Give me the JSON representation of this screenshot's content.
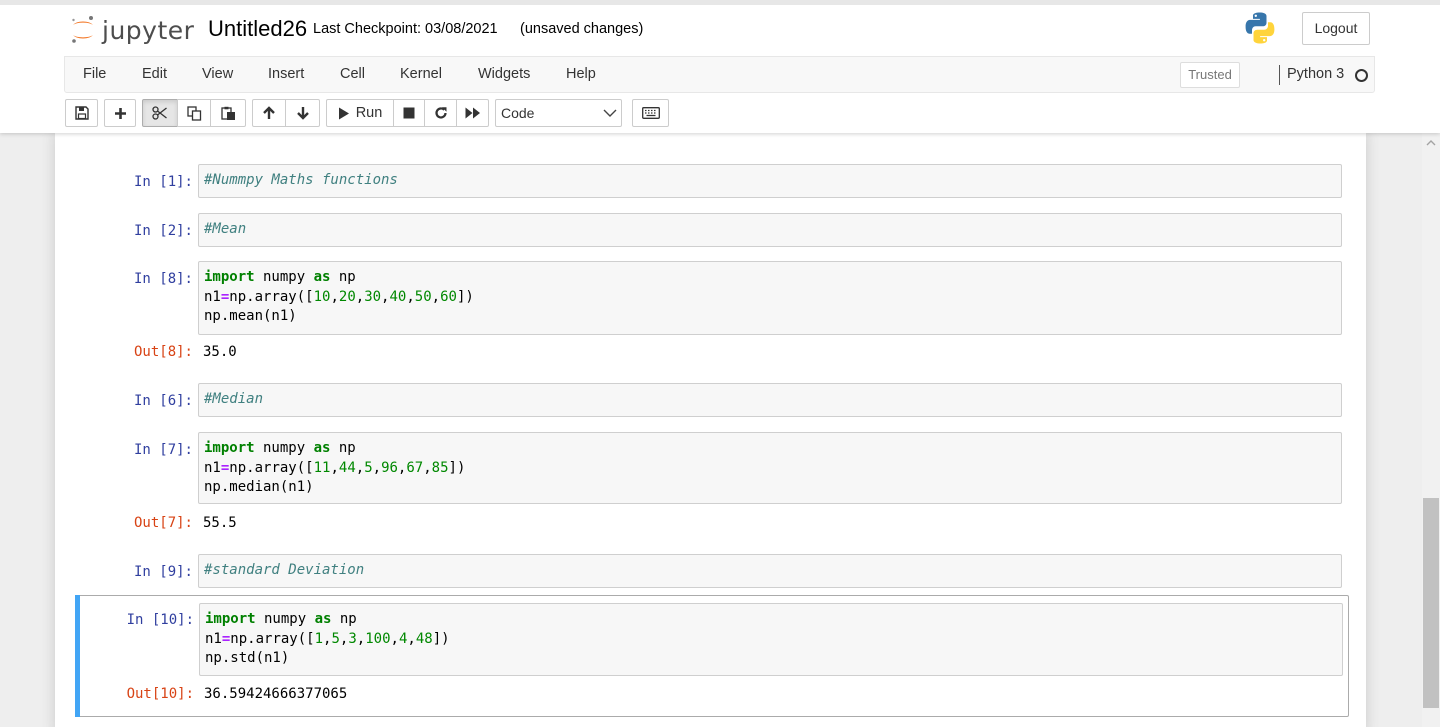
{
  "header": {
    "logo_text": "jupyter",
    "notebook_name": "Untitled26",
    "checkpoint": "Last Checkpoint: 03/08/2021",
    "autosave_status": "(unsaved changes)",
    "logout_label": "Logout"
  },
  "menubar": {
    "items": [
      "File",
      "Edit",
      "View",
      "Insert",
      "Cell",
      "Kernel",
      "Widgets",
      "Help"
    ],
    "trusted_label": "Trusted",
    "kernel_name": "Python 3"
  },
  "toolbar": {
    "run_label": "Run",
    "cell_type": "Code",
    "cell_type_options": [
      "Code"
    ],
    "icons": [
      "save-icon",
      "plus-icon",
      "cut-icon",
      "copy-icon",
      "paste-icon",
      "arrow-up-icon",
      "arrow-down-icon",
      "play-icon",
      "stop-icon",
      "restart-icon",
      "fast-forward-icon",
      "keyboard-icon"
    ]
  },
  "cells": [
    {
      "prompt": "In [1]:",
      "lines": [
        [
          {
            "t": "#Nummpy Maths functions",
            "c": "comment"
          }
        ]
      ]
    },
    {
      "prompt": "In [2]:",
      "lines": [
        [
          {
            "t": "#Mean",
            "c": "comment"
          }
        ]
      ]
    },
    {
      "prompt": "In [8]:",
      "lines": [
        [
          {
            "t": "import",
            "c": "kw"
          },
          {
            "t": " numpy ",
            "c": ""
          },
          {
            "t": "as",
            "c": "kw"
          },
          {
            "t": " np",
            "c": ""
          }
        ],
        [
          {
            "t": "n1",
            "c": ""
          },
          {
            "t": "=",
            "c": "op"
          },
          {
            "t": "np.array([",
            "c": ""
          },
          {
            "t": "10",
            "c": "num"
          },
          {
            "t": ",",
            "c": ""
          },
          {
            "t": "20",
            "c": "num"
          },
          {
            "t": ",",
            "c": ""
          },
          {
            "t": "30",
            "c": "num"
          },
          {
            "t": ",",
            "c": ""
          },
          {
            "t": "40",
            "c": "num"
          },
          {
            "t": ",",
            "c": ""
          },
          {
            "t": "50",
            "c": "num"
          },
          {
            "t": ",",
            "c": ""
          },
          {
            "t": "60",
            "c": "num"
          },
          {
            "t": "])",
            "c": ""
          }
        ],
        [
          {
            "t": "np.mean(n1)",
            "c": ""
          }
        ]
      ],
      "out_prompt": "Out[8]:",
      "output": "35.0"
    },
    {
      "prompt": "In [6]:",
      "lines": [
        [
          {
            "t": "#Median",
            "c": "comment"
          }
        ]
      ]
    },
    {
      "prompt": "In [7]:",
      "lines": [
        [
          {
            "t": "import",
            "c": "kw"
          },
          {
            "t": " numpy ",
            "c": ""
          },
          {
            "t": "as",
            "c": "kw"
          },
          {
            "t": " np",
            "c": ""
          }
        ],
        [
          {
            "t": "n1",
            "c": ""
          },
          {
            "t": "=",
            "c": "op"
          },
          {
            "t": "np.array([",
            "c": ""
          },
          {
            "t": "11",
            "c": "num"
          },
          {
            "t": ",",
            "c": ""
          },
          {
            "t": "44",
            "c": "num"
          },
          {
            "t": ",",
            "c": ""
          },
          {
            "t": "5",
            "c": "num"
          },
          {
            "t": ",",
            "c": ""
          },
          {
            "t": "96",
            "c": "num"
          },
          {
            "t": ",",
            "c": ""
          },
          {
            "t": "67",
            "c": "num"
          },
          {
            "t": ",",
            "c": ""
          },
          {
            "t": "85",
            "c": "num"
          },
          {
            "t": "])",
            "c": ""
          }
        ],
        [
          {
            "t": "np.median(n1)",
            "c": ""
          }
        ]
      ],
      "out_prompt": "Out[7]:",
      "output": "55.5"
    },
    {
      "prompt": "In [9]:",
      "lines": [
        [
          {
            "t": "#standard Deviation",
            "c": "comment"
          }
        ]
      ]
    },
    {
      "prompt": "In [10]:",
      "selected": true,
      "lines": [
        [
          {
            "t": "import",
            "c": "kw"
          },
          {
            "t": " numpy ",
            "c": ""
          },
          {
            "t": "as",
            "c": "kw"
          },
          {
            "t": " np",
            "c": ""
          }
        ],
        [
          {
            "t": "n1",
            "c": ""
          },
          {
            "t": "=",
            "c": "op"
          },
          {
            "t": "np.array([",
            "c": ""
          },
          {
            "t": "1",
            "c": "num"
          },
          {
            "t": ",",
            "c": ""
          },
          {
            "t": "5",
            "c": "num"
          },
          {
            "t": ",",
            "c": ""
          },
          {
            "t": "3",
            "c": "num"
          },
          {
            "t": ",",
            "c": ""
          },
          {
            "t": "100",
            "c": "num"
          },
          {
            "t": ",",
            "c": ""
          },
          {
            "t": "4",
            "c": "num"
          },
          {
            "t": ",",
            "c": ""
          },
          {
            "t": "48",
            "c": "num"
          },
          {
            "t": "])",
            "c": ""
          }
        ],
        [
          {
            "t": "np.std(n1)",
            "c": ""
          }
        ]
      ],
      "out_prompt": "Out[10]:",
      "output": "36.59424666377065"
    }
  ],
  "colors": {
    "in_prompt": "#303f9f",
    "out_prompt": "#d84315",
    "selected_cell_bar": "#42a5f5",
    "comment": "#408080",
    "keyword": "#008000",
    "number": "#008800",
    "operator": "#aa22ff"
  }
}
